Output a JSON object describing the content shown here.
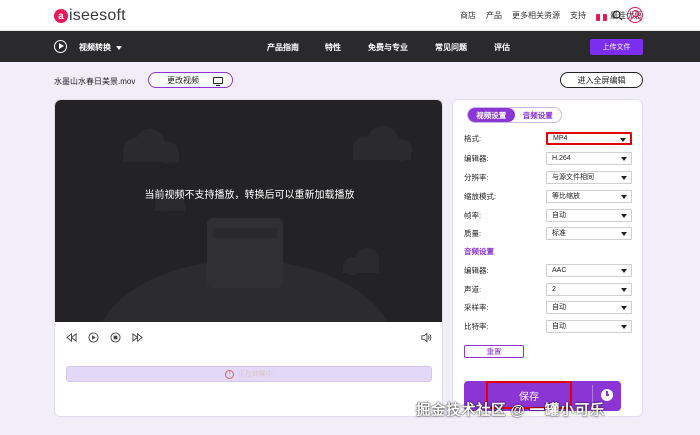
{
  "topbar": {
    "logo_text": "aiseesoft",
    "nav": [
      "商店",
      "产品",
      "更多相关资源",
      "支持"
    ],
    "promo_label": "最佳优惠"
  },
  "darknav": {
    "product_label": "视频转换",
    "links": [
      "产品指南",
      "特性",
      "免费与专业",
      "常见问题",
      "评估"
    ],
    "upload_label": "上传文件"
  },
  "file": {
    "name": "水墨山水春日美景.mov",
    "change_video_label": "更改视频",
    "fullscreen_label": "进入全屏编辑"
  },
  "player": {
    "message": "当前视频不支持播放，转换后可以重新加载播放",
    "progress_text": "正在转换中"
  },
  "settings": {
    "tabs": [
      "视频设置",
      "音频设置"
    ],
    "video": [
      {
        "label": "格式:",
        "value": "MP4"
      },
      {
        "label": "编辑器:",
        "value": "H.264"
      },
      {
        "label": "分辨率:",
        "value": "与源文件相同"
      },
      {
        "label": "缩放模式:",
        "value": "等比缩放"
      },
      {
        "label": "帧率:",
        "value": "自动"
      },
      {
        "label": "质量:",
        "value": "标准"
      }
    ],
    "audio_section_title": "音频设置",
    "audio": [
      {
        "label": "编辑器:",
        "value": "AAC"
      },
      {
        "label": "声道:",
        "value": "2"
      },
      {
        "label": "采样率:",
        "value": "自动"
      },
      {
        "label": "比特率:",
        "value": "自动"
      }
    ],
    "reset_label": "重置",
    "save_label": "保存"
  },
  "watermark": "掘金技术社区 @ 一罐小可乐",
  "colors": {
    "accent": "#8a35d4",
    "brand_pink": "#e8185b",
    "highlight_red": "#e00000",
    "dark_nav": "#2a2a2c"
  }
}
